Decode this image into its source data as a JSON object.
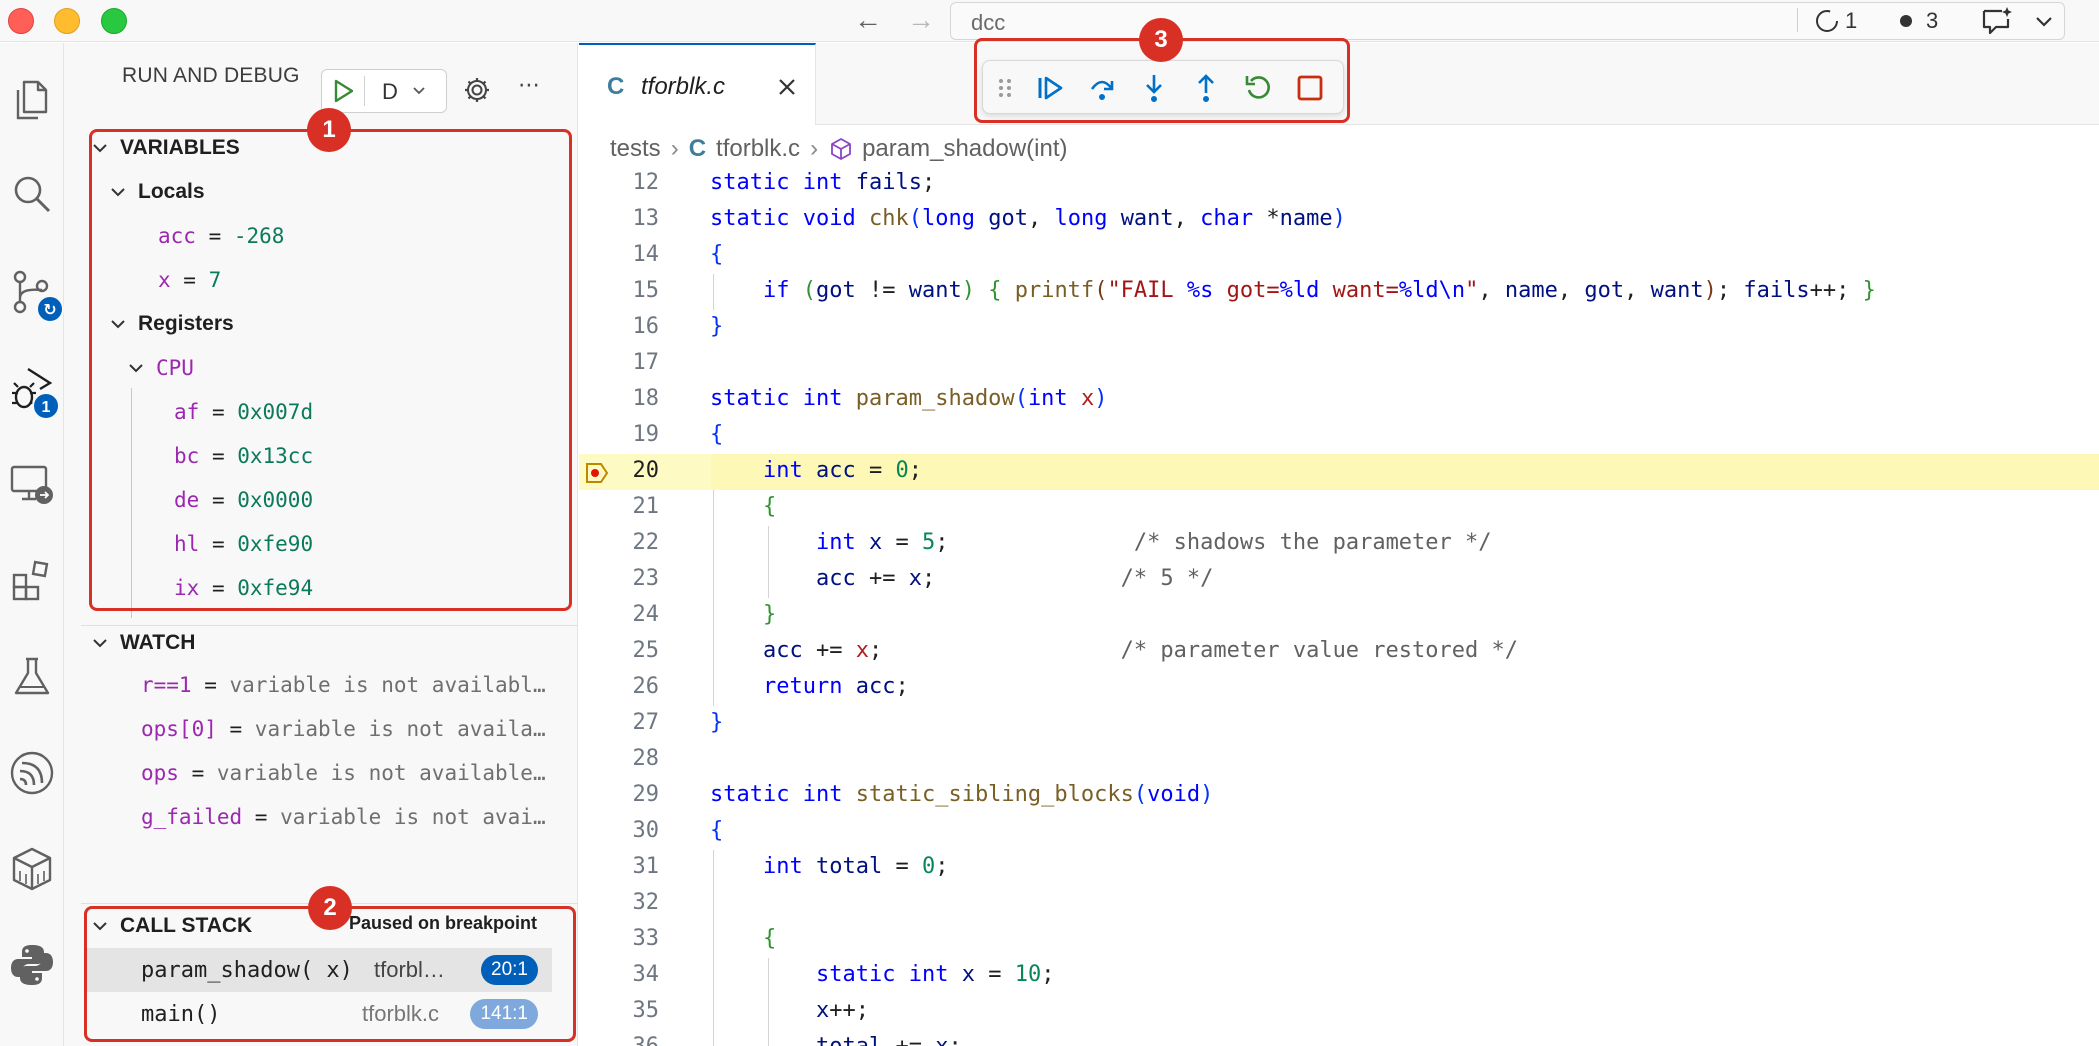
{
  "window": {
    "search_text": "dcc",
    "status_count_1": "1",
    "status_count_2": "3"
  },
  "activity_bar": {
    "run_debug_badge": "1"
  },
  "sidebar": {
    "title": "RUN AND DEBUG",
    "config_name": "D",
    "variables": {
      "header": "VARIABLES",
      "locals_label": "Locals",
      "locals": [
        {
          "name": "acc",
          "value": "-268"
        },
        {
          "name": "x",
          "value": "7"
        }
      ],
      "registers_label": "Registers",
      "cpu_label": "CPU",
      "cpu": [
        {
          "name": "af",
          "value": "0x007d"
        },
        {
          "name": "bc",
          "value": "0x13cc"
        },
        {
          "name": "de",
          "value": "0x0000"
        },
        {
          "name": "hl",
          "value": "0xfe90"
        },
        {
          "name": "ix",
          "value": "0xfe94"
        }
      ]
    },
    "watch": {
      "header": "WATCH",
      "items": [
        {
          "name": "r==1",
          "value": "variable is not availabl…"
        },
        {
          "name": "ops[0]",
          "value": "variable is not availa…"
        },
        {
          "name": "ops",
          "value": "variable is not available…"
        },
        {
          "name": "g_failed",
          "value": "variable is not avai…"
        }
      ]
    },
    "call_stack": {
      "header": "CALL STACK",
      "status": "Paused on breakpoint",
      "frames": [
        {
          "func": "param_shadow( x)",
          "file": "tforbl…",
          "pos": "20:1"
        },
        {
          "func": "main()",
          "file": "tforblk.c",
          "pos": "141:1"
        }
      ]
    }
  },
  "annotations": {
    "box1": "1",
    "box2": "2",
    "box3": "3"
  },
  "editor": {
    "tab_icon": "C",
    "tab_title": "tforblk.c",
    "breadcrumb": {
      "folder": "tests",
      "file_icon": "C",
      "file": "tforblk.c",
      "symbol": "param_shadow(int)"
    },
    "line_numbers": [
      "12",
      "13",
      "14",
      "15",
      "16",
      "17",
      "18",
      "19",
      "20",
      "21",
      "22",
      "23",
      "24",
      "25",
      "26",
      "27",
      "28",
      "29",
      "30",
      "31",
      "32",
      "33",
      "34",
      "35",
      "36"
    ],
    "current_line": "20"
  },
  "colors": {
    "accent": "#005fb8",
    "annotation_red": "#d93025",
    "current_line_bg": "#fdfbc3",
    "debug_green": "#388a34"
  }
}
